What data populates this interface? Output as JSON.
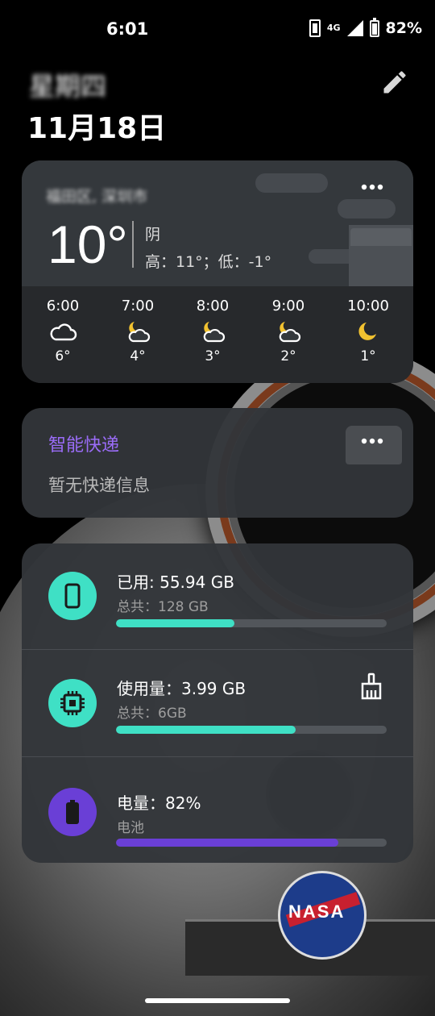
{
  "status_bar": {
    "time": "6:01",
    "network": "4G",
    "battery_percent": "82%"
  },
  "header": {
    "weekday": "星期四",
    "date": "11月18日"
  },
  "weather": {
    "location": "福田区, 深圳市",
    "temperature": "10°",
    "condition": "阴",
    "high_low": "高：11°；低：-1°",
    "hourly": [
      {
        "time": "6:00",
        "icon": "cloud-icon",
        "temp": "6°"
      },
      {
        "time": "7:00",
        "icon": "moon-cloud-icon",
        "temp": "4°"
      },
      {
        "time": "8:00",
        "icon": "moon-cloud-icon",
        "temp": "3°"
      },
      {
        "time": "9:00",
        "icon": "moon-cloud-icon",
        "temp": "2°"
      },
      {
        "time": "10:00",
        "icon": "moon-icon",
        "temp": "1°"
      }
    ]
  },
  "express": {
    "title": "智能快递",
    "status": "暂无快递信息"
  },
  "system": {
    "storage": {
      "main": "已用: 55.94 GB",
      "sub": "总共：128 GB",
      "fraction": 0.437,
      "color": "#3fe0c5"
    },
    "memory": {
      "main": "使用量：3.99 GB",
      "sub": "总共：6GB",
      "fraction": 0.665,
      "color": "#3fe0c5"
    },
    "battery": {
      "main": "电量：82%",
      "sub": "电池",
      "fraction": 0.82,
      "color": "#6a3fd6"
    }
  },
  "colors": {
    "teal": "#3fe0c5",
    "purple": "#6a3fd6",
    "express_title": "#9a6cf7",
    "moon": "#f2c230"
  }
}
